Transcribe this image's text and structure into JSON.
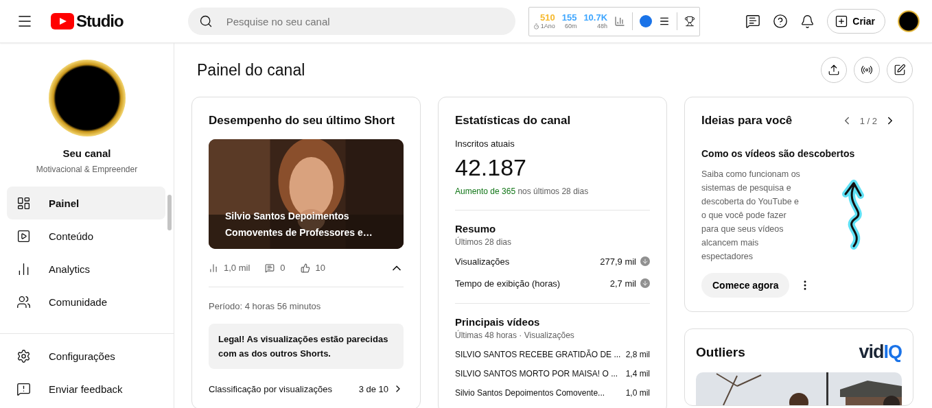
{
  "header": {
    "logo_text": "Studio",
    "search_placeholder": "Pesquise no seu canal",
    "stats": [
      {
        "value": "510",
        "label": "1Ano",
        "color": "#f6b82b",
        "timer": true
      },
      {
        "value": "155",
        "label": "60m",
        "color": "#3ea6ff",
        "timer": false
      },
      {
        "value": "10.7K",
        "label": "48h",
        "color": "#3ea6ff",
        "timer": false
      }
    ],
    "create_label": "Criar"
  },
  "sidebar": {
    "channel_name": "Seu canal",
    "channel_subtitle": "Motivacional & Empreender",
    "items": [
      {
        "kind": "dashboard",
        "label": "Painel",
        "selected": true
      },
      {
        "kind": "content",
        "label": "Conteúdo",
        "selected": false
      },
      {
        "kind": "analytics",
        "label": "Analytics",
        "selected": false
      },
      {
        "kind": "community",
        "label": "Comunidade",
        "selected": false
      }
    ],
    "bottom_items": [
      {
        "kind": "settings",
        "label": "Configurações"
      },
      {
        "kind": "feedback",
        "label": "Enviar feedback"
      }
    ]
  },
  "page_title": "Painel do canal",
  "short_card": {
    "title": "Desempenho do seu último Short",
    "video_title": "Silvio Santos Depoimentos Comoventes de Professores e…",
    "views": "1,0 mil",
    "comments": "0",
    "likes": "10",
    "expanded": true,
    "period": "Período: 4 horas 56 minutos",
    "message": "Legal! As visualizações estão parecidas com as dos outros Shorts.",
    "rows": [
      {
        "kind": "rank",
        "label": "Classificação por visualizações",
        "value": "3 de 10"
      }
    ]
  },
  "stats_card": {
    "title": "Estatísticas do canal",
    "subs_label": "Inscritos atuais",
    "subs_value": "42.187",
    "growth_value": "Aumento de 365",
    "growth_text": "nos últimos 28 dias",
    "summary_title": "Resumo",
    "summary_period": "Últimos 28 dias",
    "summary_rows": [
      {
        "label": "Visualizações",
        "value": "277,9 mil"
      },
      {
        "label": "Tempo de exibição (horas)",
        "value": "2,7 mil"
      }
    ],
    "top_title": "Principais vídeos",
    "top_period": "Últimas 48 horas · Visualizações",
    "top_videos": [
      {
        "title": "SILVIO SANTOS RECEBE GRATIDÃO DE ...",
        "views": "2,8 mil"
      },
      {
        "title": "SILVIO SANTOS MORTO POR MAISA! O ...",
        "views": "1,4 mil"
      },
      {
        "title": "Silvio Santos Depoimentos Comovente...",
        "views": "1,0 mil"
      }
    ]
  },
  "ideas_card": {
    "title": "Ideias para você",
    "pager": "1 / 2",
    "heading": "Como os vídeos são descobertos",
    "text": "Saiba como funcionam os sistemas de pesquisa e descoberta do YouTube e o que você pode fazer para que seus vídeos alcancem mais espectadores",
    "button": "Comece agora"
  },
  "outliers_card": {
    "title": "Outliers",
    "logo_dark": "vid",
    "logo_blue": "IQ"
  }
}
